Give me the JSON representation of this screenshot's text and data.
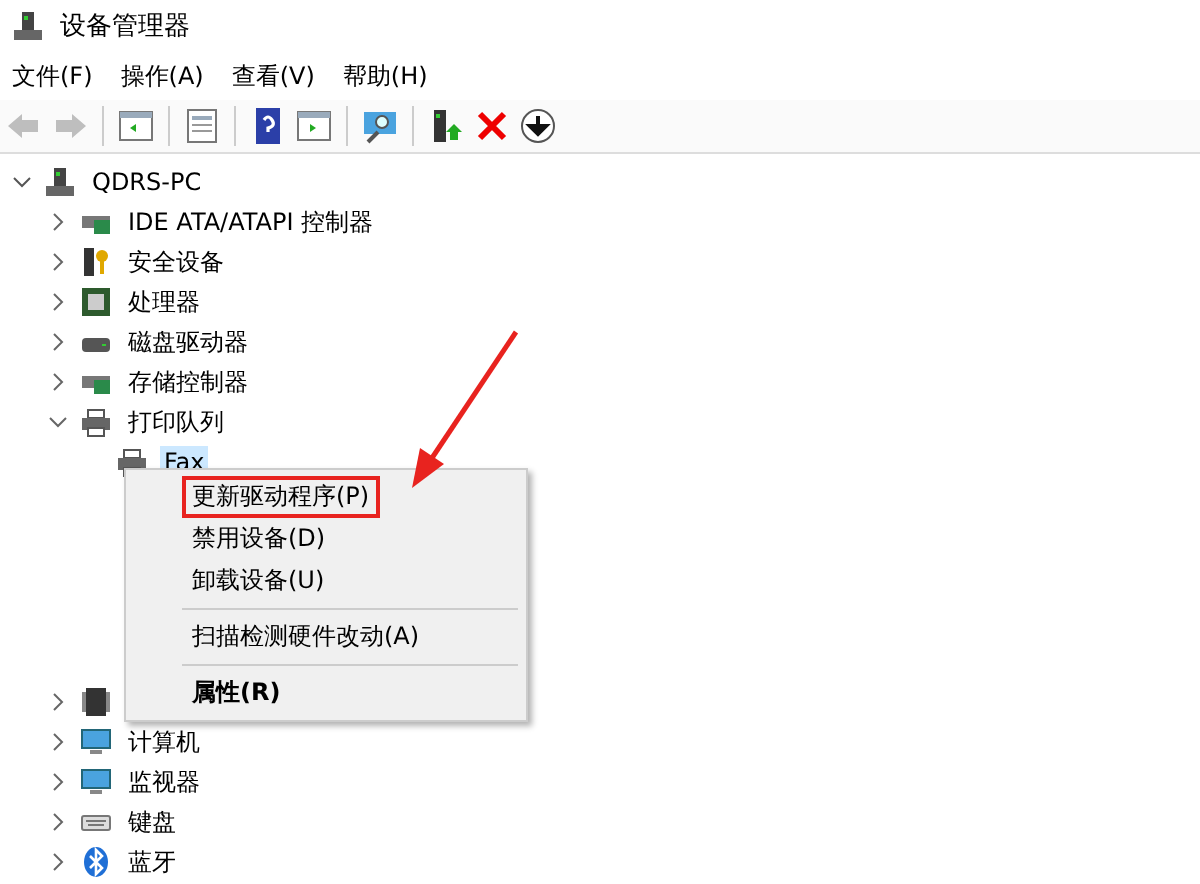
{
  "window": {
    "title": "设备管理器"
  },
  "menu_bar": [
    "文件(F)",
    "操作(A)",
    "查看(V)",
    "帮助(H)"
  ],
  "toolbar": [
    {
      "kind": "back",
      "disabled": true
    },
    {
      "kind": "forward",
      "disabled": true
    },
    {
      "kind": "sep"
    },
    {
      "kind": "panel"
    },
    {
      "kind": "sep"
    },
    {
      "kind": "props"
    },
    {
      "kind": "sep"
    },
    {
      "kind": "help"
    },
    {
      "kind": "panel2"
    },
    {
      "kind": "sep"
    },
    {
      "kind": "scan"
    },
    {
      "kind": "sep"
    },
    {
      "kind": "update"
    },
    {
      "kind": "remove"
    },
    {
      "kind": "down"
    }
  ],
  "tree": {
    "label": "QDRS-PC",
    "kind": "pc",
    "expanded": true,
    "children": [
      {
        "label": "IDE ATA/ATAPI 控制器",
        "kind": "card",
        "expanded": false
      },
      {
        "label": "安全设备",
        "kind": "key",
        "expanded": false
      },
      {
        "label": "处理器",
        "kind": "cpu",
        "expanded": false
      },
      {
        "label": "磁盘驱动器",
        "kind": "disk",
        "expanded": false
      },
      {
        "label": "存储控制器",
        "kind": "card",
        "expanded": false
      },
      {
        "label": "打印队列",
        "kind": "printer",
        "expanded": true,
        "children": [
          {
            "label": "Fax",
            "kind": "printer",
            "selected": true
          }
        ]
      },
      {
        "kind": "chip",
        "expanded": false
      },
      {
        "label": "计算机",
        "kind": "monitor",
        "expanded": false
      },
      {
        "label": "监视器",
        "kind": "monitor",
        "expanded": false
      },
      {
        "label": "键盘",
        "kind": "keyboard",
        "expanded": false
      },
      {
        "label": "蓝牙",
        "kind": "bluetooth",
        "expanded": false
      }
    ]
  },
  "context_menu": [
    {
      "label": "更新驱动程序(P)",
      "highlighted": true,
      "bold": false
    },
    {
      "label": "禁用设备(D)",
      "highlighted": false,
      "bold": false
    },
    {
      "label": "卸载设备(U)",
      "highlighted": false,
      "bold": false
    },
    {
      "kind": "separator"
    },
    {
      "label": "扫描检测硬件改动(A)",
      "highlighted": false,
      "bold": false
    },
    {
      "kind": "separator"
    },
    {
      "label": "属性(R)",
      "highlighted": false,
      "bold": true
    }
  ],
  "annotation": {
    "kind": "arrow"
  }
}
